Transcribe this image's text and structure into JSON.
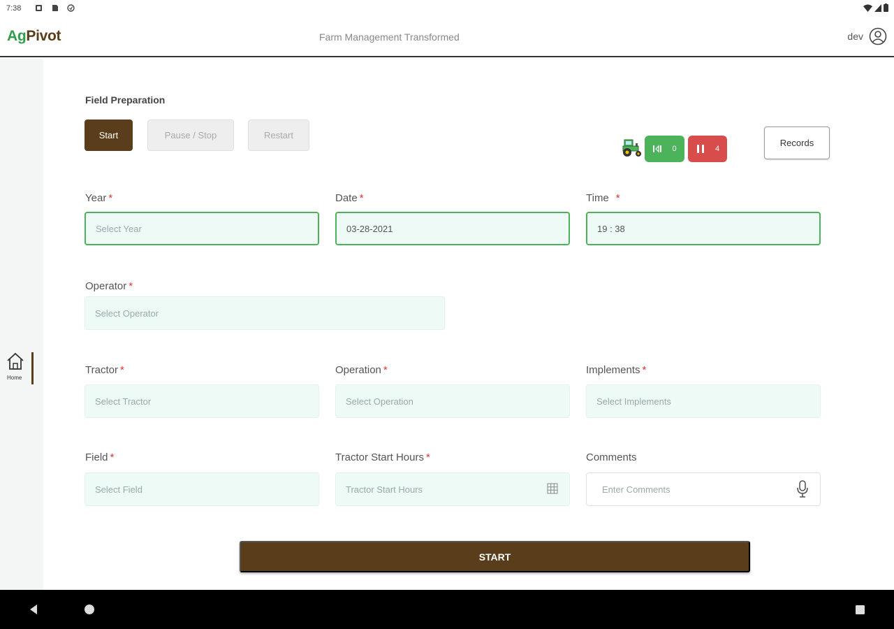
{
  "status_bar": {
    "time": "7:38"
  },
  "app": {
    "logo_ag": "Ag",
    "logo_pivot": "Pivot",
    "tagline": "Farm Management Transformed",
    "user_name": "dev"
  },
  "rail": {
    "home_label": "Home"
  },
  "section": {
    "title": "Field Preparation"
  },
  "controls": {
    "start": "Start",
    "pause_stop": "Pause / Stop",
    "restart": "Restart",
    "green_count": "0",
    "red_count": "4",
    "records": "Records"
  },
  "form": {
    "year": {
      "label": "Year",
      "placeholder": "Select Year"
    },
    "date": {
      "label": "Date",
      "value": "03-28-2021"
    },
    "time": {
      "label": "Time",
      "value": "19 : 38"
    },
    "operator": {
      "label": "Operator",
      "placeholder": "Select Operator"
    },
    "tractor": {
      "label": "Tractor",
      "placeholder": "Select Tractor"
    },
    "operation": {
      "label": "Operation",
      "placeholder": "Select Operation"
    },
    "implements": {
      "label": "Implements",
      "placeholder": "Select Implements"
    },
    "field": {
      "label": "Field",
      "placeholder": "Select Field"
    },
    "tractor_start_hours": {
      "label": "Tractor Start Hours",
      "placeholder": "Tractor Start Hours"
    },
    "comments": {
      "label": "Comments",
      "placeholder": "Enter Comments"
    },
    "required_mark": "*"
  },
  "submit": {
    "label": "START"
  },
  "colors": {
    "brand_brown": "#5a3e1b",
    "brand_green": "#2e9e4c",
    "accent_green": "#4cb35a",
    "accent_red": "#d94c4c",
    "field_bg": "#eefaf6"
  }
}
